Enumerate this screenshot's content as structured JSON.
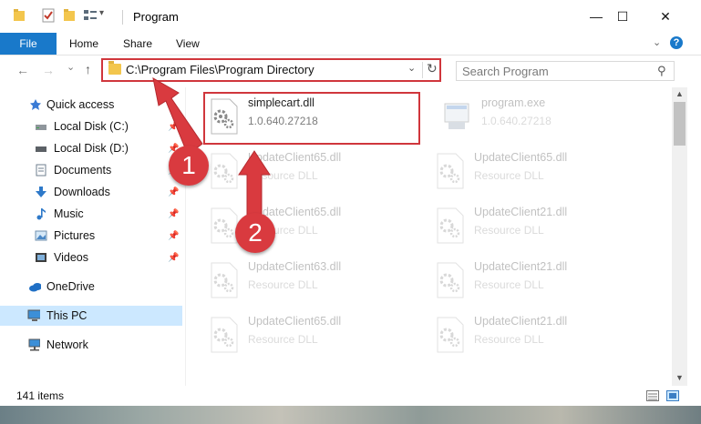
{
  "window": {
    "title": "Program",
    "minimize_glyph": "—",
    "maximize_glyph": "☐",
    "close_glyph": "✕"
  },
  "ribbon": {
    "tabs": [
      "File",
      "Home",
      "Share",
      "View"
    ],
    "expand_glyph": "⌄",
    "help_glyph": "?"
  },
  "navigation": {
    "back_glyph": "←",
    "forward_glyph": "→",
    "recent_glyph": "⌄",
    "up_glyph": "↑",
    "address": "C:\\Program Files\\Program Directory",
    "address_dropdown_glyph": "⌄",
    "refresh_glyph": "↻",
    "search_placeholder": "Search Program",
    "search_glyph": "⚲"
  },
  "sidebar": {
    "items": [
      {
        "label": "Quick access",
        "icon": "star-icon",
        "pinned": false
      },
      {
        "label": "Local Disk (C:)",
        "icon": "drive-icon",
        "pinned": true
      },
      {
        "label": "Local Disk (D:)",
        "icon": "drive-icon",
        "pinned": true
      },
      {
        "label": "Documents",
        "icon": "document-icon",
        "pinned": true
      },
      {
        "label": "Downloads",
        "icon": "download-icon",
        "pinned": true
      },
      {
        "label": "Music",
        "icon": "music-icon",
        "pinned": true
      },
      {
        "label": "Pictures",
        "icon": "pictures-icon",
        "pinned": true
      },
      {
        "label": "Videos",
        "icon": "video-icon",
        "pinned": true
      },
      {
        "label": "OneDrive",
        "icon": "cloud-icon",
        "pinned": false
      },
      {
        "label": "This PC",
        "icon": "computer-icon",
        "pinned": false,
        "selected": true
      },
      {
        "label": "Network",
        "icon": "network-icon",
        "pinned": false
      }
    ],
    "pin_glyph": "📌"
  },
  "files": [
    {
      "name": "simplecart.dll",
      "detail": "1.0.640.27218",
      "highlighted": true
    },
    {
      "name": "program.exe",
      "detail": "1.0.640.27218",
      "highlighted": false
    },
    {
      "name": "UpdateClient65.dll",
      "detail": "Resource DLL",
      "highlighted": false
    },
    {
      "name": "UpdateClient65.dll",
      "detail": "Resource DLL",
      "highlighted": false
    },
    {
      "name": "UpdateClient65.dll",
      "detail": "Resource DLL",
      "highlighted": false
    },
    {
      "name": "UpdateClient21.dll",
      "detail": "Resource DLL",
      "highlighted": false
    },
    {
      "name": "UpdateClient63.dll",
      "detail": "Resource DLL",
      "highlighted": false
    },
    {
      "name": "UpdateClient21.dll",
      "detail": "Resource DLL",
      "highlighted": false
    },
    {
      "name": "UpdateClient65.dll",
      "detail": "Resource DLL",
      "highlighted": false
    },
    {
      "name": "UpdateClient21.dll",
      "detail": "Resource DLL",
      "highlighted": false
    }
  ],
  "status": {
    "item_count": "141 items"
  },
  "callouts": {
    "step1": "1",
    "step2": "2",
    "color": "#d93a3f"
  },
  "colors": {
    "accent": "#1979ca",
    "highlight_border": "#d0363c",
    "selection": "#cce8ff"
  }
}
